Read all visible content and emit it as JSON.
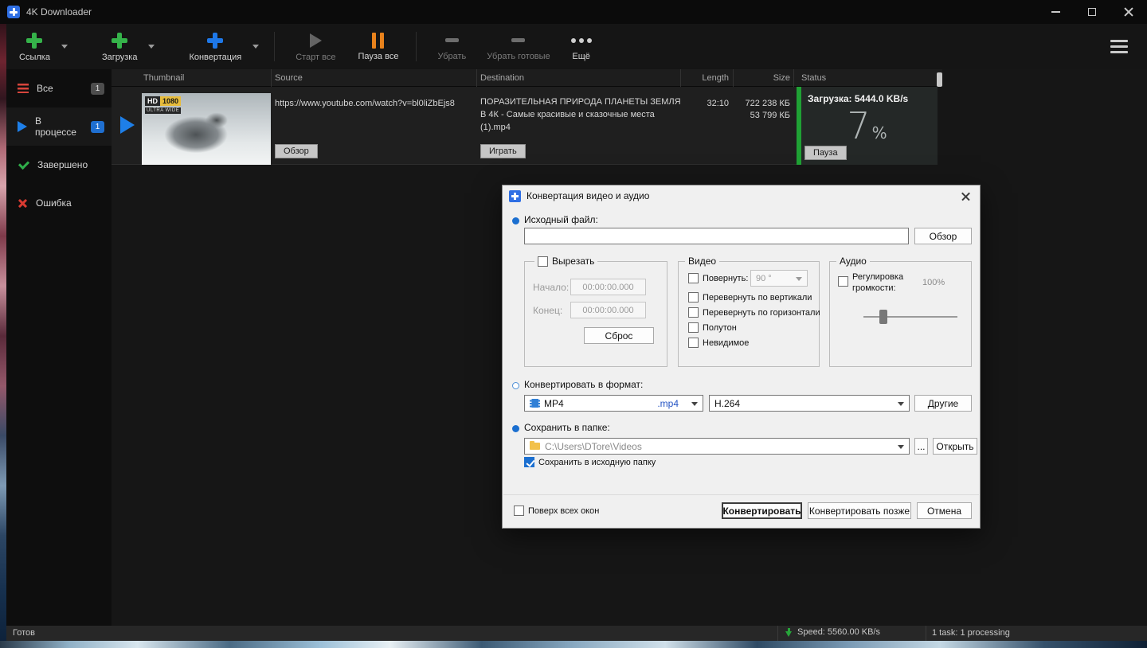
{
  "window": {
    "title": "4K Downloader"
  },
  "toolbar": {
    "link": "Ссылка",
    "download": "Загрузка",
    "convert": "Конвертация",
    "start_all": "Старт все",
    "pause_all": "Пауза все",
    "remove": "Убрать",
    "remove_done": "Убрать готовые",
    "more": "Ещё"
  },
  "sidebar": {
    "items": [
      {
        "label": "Все",
        "badge": "1"
      },
      {
        "label": "В процессе",
        "badge": "1"
      },
      {
        "label": "Завершено"
      },
      {
        "label": "Ошибка"
      }
    ]
  },
  "table": {
    "headers": [
      "Thumbnail",
      "Source",
      "Destination",
      "Length",
      "Size",
      "Status"
    ],
    "row": {
      "thumb_badge_hd": "HD",
      "thumb_badge_res": "1080",
      "thumb_badge_ultra": "ULTRA WIDE",
      "source_url": "https://www.youtube.com/watch?v=bl0liZbEjs8",
      "source_button": "Обзор",
      "destination": "ПОРАЗИТЕЛЬНАЯ ПРИРОДА ПЛАНЕТЫ ЗЕМЛЯ В 4К - Самые красивые и сказочные места (1).mp4",
      "destination_button": "Играть",
      "length": "32:10",
      "size_total": "722 238 КБ",
      "size_done": "53 799 КБ",
      "status_label": "Загрузка: 5444.0 KB/s",
      "progress_value": "7",
      "progress_unit": "%",
      "status_button": "Пауза"
    }
  },
  "dialog": {
    "title": "Конвертация видео и аудио",
    "source_label": "Исходный файл:",
    "source_value": "",
    "browse_button": "Обзор",
    "cut_group": {
      "label": "Вырезать",
      "start_label": "Начало:",
      "start_value": "00:00:00.000",
      "end_label": "Конец:",
      "end_value": "00:00:00.000",
      "reset_button": "Сброс"
    },
    "video_group": {
      "label": "Видео",
      "rotate_label": "Повернуть:",
      "rotate_value": "90 °",
      "flip_v": "Перевернуть по вертикали",
      "flip_h": "Перевернуть по горизонтали",
      "halftone": "Полутон",
      "invisible": "Невидимое"
    },
    "audio_group": {
      "label": "Аудио",
      "volume_label": "Регулировка громкости:",
      "volume_value": "100%"
    },
    "format_label": "Конвертировать в формат:",
    "format_value": "MP4",
    "format_ext": ".mp4",
    "codec_value": "H.264",
    "others_button": "Другие",
    "folder_label": "Сохранить в папке:",
    "folder_value": "C:\\Users\\DTore\\Videos",
    "dots_button": "...",
    "open_button": "Открыть",
    "save_source_checkbox": "Сохранить в исходную папку",
    "ontop_checkbox": "Поверх всех окон",
    "convert_button": "Конвертировать",
    "convert_later_button": "Конвертировать позже",
    "cancel_button": "Отмена"
  },
  "statusbar": {
    "ready": "Готов",
    "speed": "Speed: 5560.00 KB/s",
    "tasks": "1 task: 1 processing"
  },
  "colors": {
    "accent_blue": "#1e7fe8",
    "plus_green": "#35b34a",
    "plus_blue": "#1e78e8",
    "pause_orange": "#e8821c",
    "error_red": "#d6453c",
    "progress_green": "#1fa134",
    "badge_blue": "#1f6fd0"
  }
}
